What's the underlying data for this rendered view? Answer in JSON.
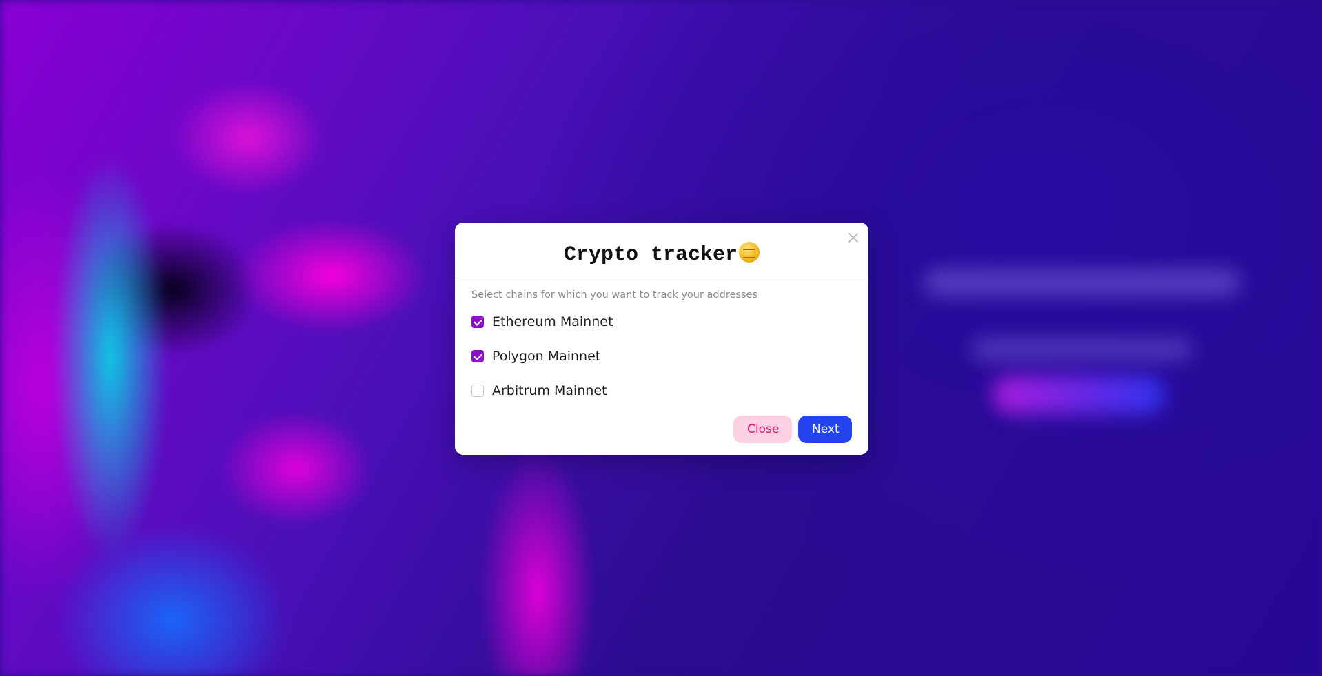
{
  "modal": {
    "title": "Crypto tracker",
    "title_icon": "coin-icon",
    "subtitle": "Select chains for which you want to track your addresses",
    "chains": [
      {
        "label": "Ethereum Mainnet",
        "checked": true
      },
      {
        "label": "Polygon Mainnet",
        "checked": true
      },
      {
        "label": "Arbitrum Mainnet",
        "checked": false
      }
    ],
    "close_label": "Close",
    "next_label": "Next"
  },
  "colors": {
    "checkbox_accent": "#8e11c9",
    "next_button": "#2445ee",
    "close_button_bg": "#fdd1e3",
    "close_button_text": "#e0186e"
  }
}
